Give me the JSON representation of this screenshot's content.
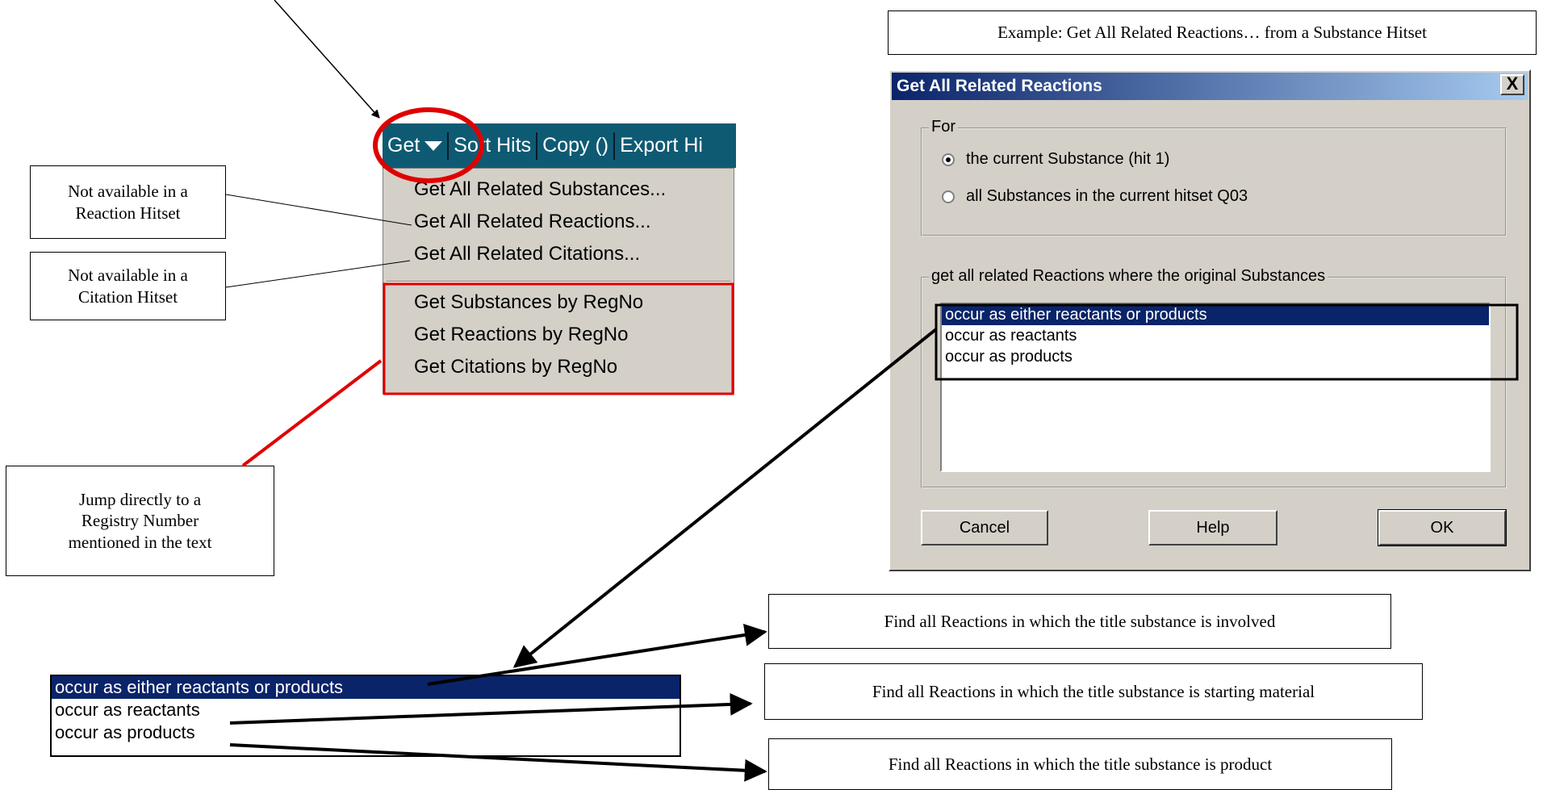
{
  "callouts": {
    "example": "Example: Get All Related Reactions… from a Substance Hitset",
    "reaction_hitset": [
      "Not available in a",
      "Reaction Hitset"
    ],
    "citation_hitset": [
      "Not available in a",
      "Citation Hitset"
    ],
    "jump": [
      "Jump directly to a",
      "Registry Number",
      "mentioned in the text"
    ],
    "involved": "Find all Reactions in which the title substance is involved",
    "starting": "Find all Reactions in which the title substance is starting material",
    "product": "Find all Reactions in which the title substance is product"
  },
  "toolbar": {
    "get": "Get",
    "sort_hits": "Sort Hits",
    "copy": "Copy ()",
    "export": "Export Hi"
  },
  "menu": {
    "items": [
      "Get All Related Substances...",
      "Get All Related Reactions...",
      "Get All Related Citations..."
    ],
    "regno_items": [
      "Get Substances by RegNo",
      "Get Reactions by RegNo",
      "Get Citations by RegNo"
    ]
  },
  "dialog": {
    "title": "Get All Related Reactions",
    "close": "X",
    "for_label": "For",
    "radio_current": "the current Substance (hit 1)",
    "radio_all": "all Substances in the current hitset Q03",
    "selected_radio": "radio_current",
    "group_label": "get all related Reactions where the original Substances",
    "options": [
      "occur as either reactants or products",
      "occur as reactants",
      "occur as products"
    ],
    "selected_option": "occur as either reactants or products",
    "cancel": "Cancel",
    "help": "Help",
    "ok": "OK"
  },
  "colors": {
    "toolbar": "#0f5a73",
    "dialog_bg": "#d4d0c8",
    "selection": "#0a246a",
    "highlight_red": "#e00000"
  }
}
